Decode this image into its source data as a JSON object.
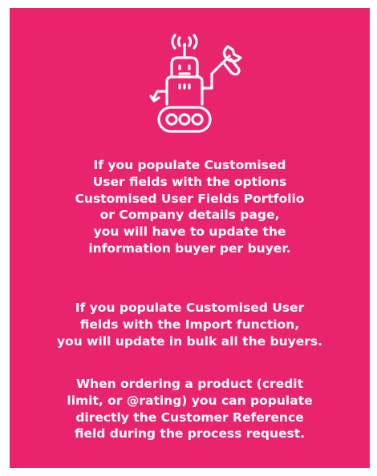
{
  "colors": {
    "background": "#e9246f",
    "text": "#ffffff",
    "page": "#ffffff"
  },
  "icon": "robot-with-wrench-icon",
  "paragraphs": [
    {
      "lines": [
        "If you populate Customised",
        "User fields with the options",
        "Customised User Fields Portfolio",
        "or Company details page,",
        "you will have to update the",
        "information buyer per buyer."
      ]
    },
    {
      "lines": [
        "If you populate Customised User",
        "fields with the Import function,",
        "you will update in bulk all the buyers."
      ]
    },
    {
      "lines": [
        "When ordering a product (credit",
        "limit, or @rating) you can populate",
        "directly the Customer Reference",
        "field during the process request."
      ]
    }
  ]
}
